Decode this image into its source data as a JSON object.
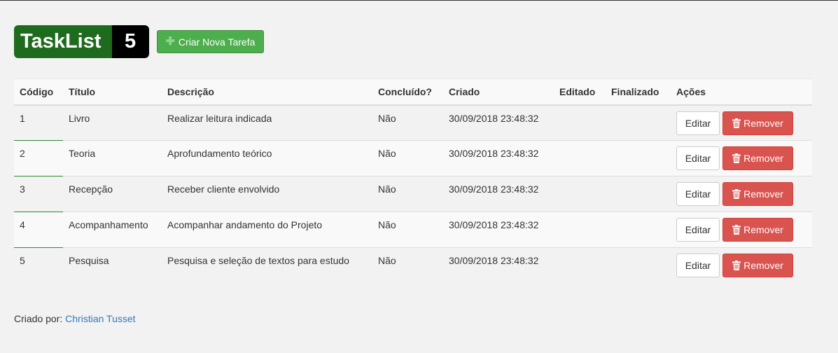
{
  "brand": {
    "name": "TaskList",
    "count": "5"
  },
  "toolbar": {
    "new_task_label": "Criar Nova Tarefa"
  },
  "table": {
    "headers": [
      "Código",
      "Título",
      "Descrição",
      "Concluído?",
      "Criado",
      "Editado",
      "Finalizado",
      "Ações"
    ],
    "rows": [
      {
        "code": "1",
        "title": "Livro",
        "description": "Realizar leitura indicada",
        "done": "Não",
        "created": "30/09/2018 23:48:32",
        "edited": "",
        "finished": "",
        "edit_label": "Editar",
        "remove_label": "Remover"
      },
      {
        "code": "2",
        "title": "Teoria",
        "description": "Aprofundamento teórico",
        "done": "Não",
        "created": "30/09/2018 23:48:32",
        "edited": "",
        "finished": "",
        "edit_label": "Editar",
        "remove_label": "Remover"
      },
      {
        "code": "3",
        "title": "Recepção",
        "description": "Receber cliente envolvido",
        "done": "Não",
        "created": "30/09/2018 23:48:32",
        "edited": "",
        "finished": "",
        "edit_label": "Editar",
        "remove_label": "Remover"
      },
      {
        "code": "4",
        "title": "Acompanhamento",
        "description": "Acompanhar andamento do Projeto",
        "done": "Não",
        "created": "30/09/2018 23:48:32",
        "edited": "",
        "finished": "",
        "edit_label": "Editar",
        "remove_label": "Remover"
      },
      {
        "code": "5",
        "title": "Pesquisa",
        "description": "Pesquisa e seleção de textos para estudo",
        "done": "Não",
        "created": "30/09/2018 23:48:32",
        "edited": "",
        "finished": "",
        "edit_label": "Editar",
        "remove_label": "Remover"
      }
    ]
  },
  "footer": {
    "prefix": "Criado por:",
    "author": "Christian Tusset"
  },
  "icons": {
    "new_task": "plus-icon",
    "remove": "trash-icon"
  },
  "colors": {
    "brand_green": "#1e6b1e",
    "success": "#4cae4c",
    "danger": "#d9534f",
    "link": "#337ab7"
  }
}
